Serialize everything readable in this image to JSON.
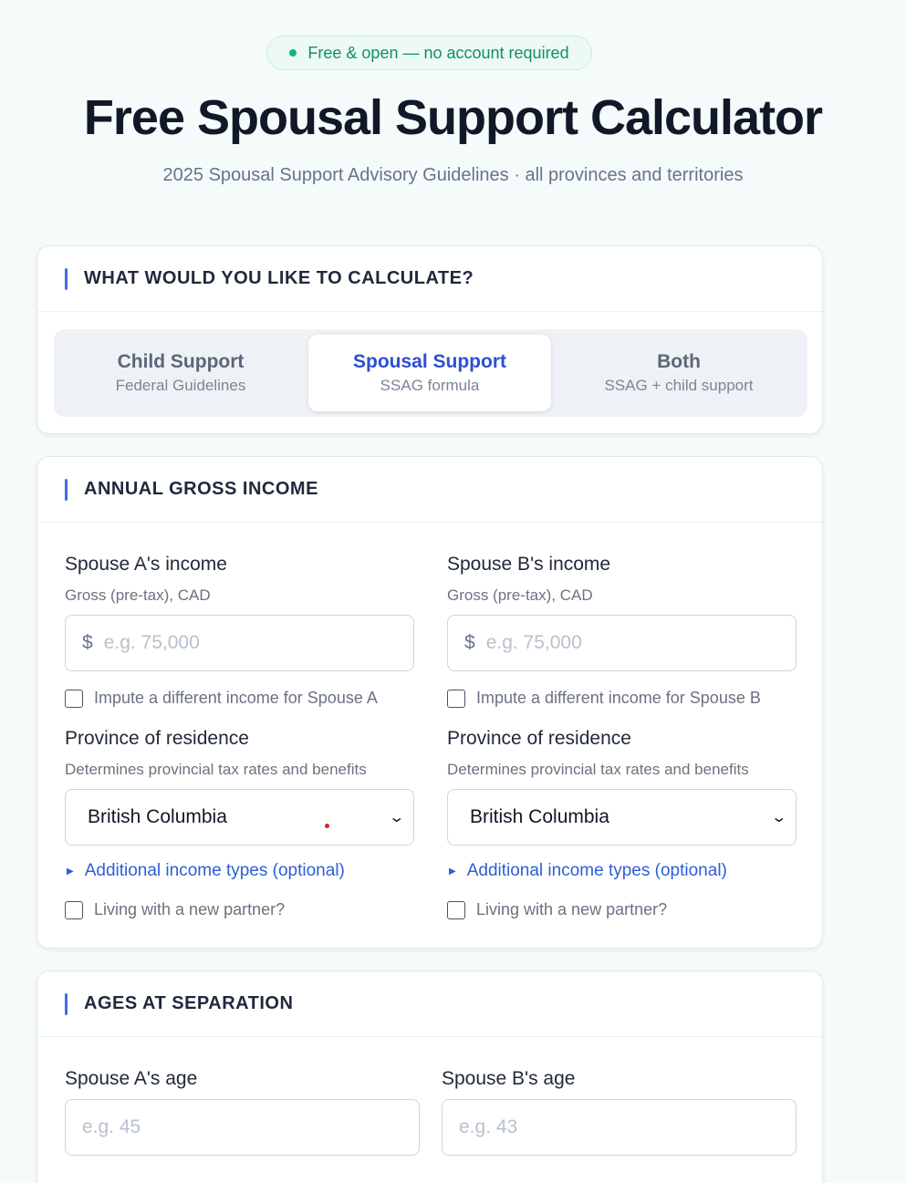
{
  "badge": {
    "text": "Free & open — no account required"
  },
  "header": {
    "title": "Free Spousal Support Calculator",
    "subtitle": "2025 Spousal Support Advisory Guidelines · all provinces and territories"
  },
  "calc_type": {
    "heading": "WHAT WOULD YOU LIKE TO CALCULATE?",
    "options": [
      {
        "title": "Child Support",
        "sub": "Federal Guidelines",
        "active": false
      },
      {
        "title": "Spousal Support",
        "sub": "SSAG formula",
        "active": true
      },
      {
        "title": "Both",
        "sub": "SSAG + child support",
        "active": false
      }
    ]
  },
  "income": {
    "heading": "ANNUAL GROSS INCOME",
    "spouse_a": {
      "label": "Spouse A's income",
      "help": "Gross (pre-tax), CAD",
      "currency": "$",
      "placeholder": "e.g. 75,000",
      "impute_label": "Impute a different income for Spouse A",
      "province_label": "Province of residence",
      "province_help": "Determines provincial tax rates and benefits",
      "province_value": "British Columbia",
      "additional_link": "Additional income types (optional)",
      "partner_label": "Living with a new partner?"
    },
    "spouse_b": {
      "label": "Spouse B's income",
      "help": "Gross (pre-tax), CAD",
      "currency": "$",
      "placeholder": "e.g. 75,000",
      "impute_label": "Impute a different income for Spouse B",
      "province_label": "Province of residence",
      "province_help": "Determines provincial tax rates and benefits",
      "province_value": "British Columbia",
      "additional_link": "Additional income types (optional)",
      "partner_label": "Living with a new partner?"
    }
  },
  "ages": {
    "heading": "AGES AT SEPARATION",
    "spouse_a": {
      "label": "Spouse A's age",
      "placeholder": "e.g. 45"
    },
    "spouse_b": {
      "label": "Spouse B's age",
      "placeholder": "e.g. 43"
    }
  },
  "colors": {
    "accent": "#2c4fd1",
    "badge_green": "#0f8f6b",
    "section_bar": "#3b6fe0"
  }
}
